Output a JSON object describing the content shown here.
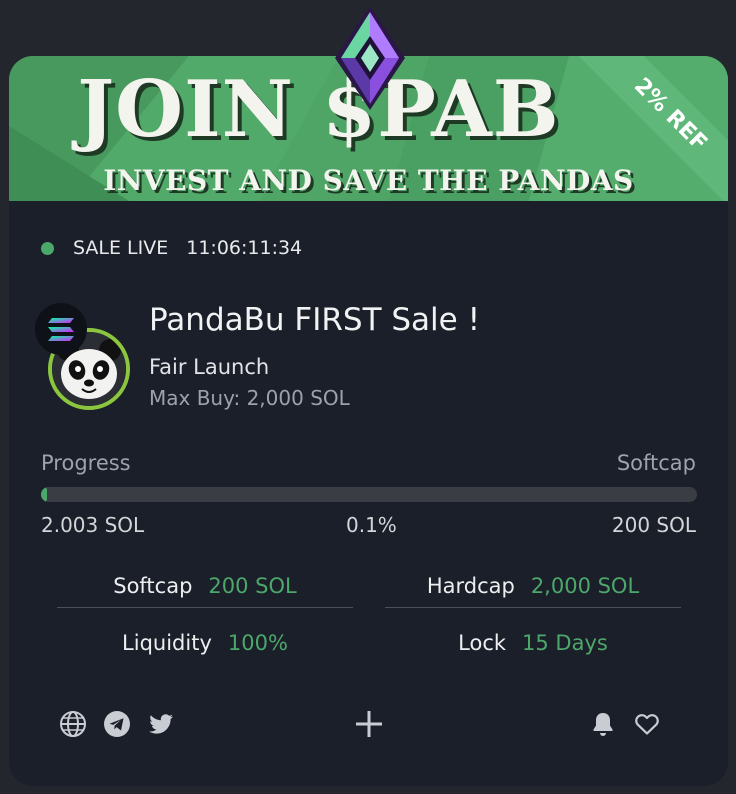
{
  "banner": {
    "title": "JOIN $PAB",
    "subtitle": "INVEST AND SAVE THE PANDAS",
    "ribbon": "2% REF",
    "colors": {
      "background": "#4fa566",
      "text": "#f4f4ee",
      "ribbon": "#5fb879"
    }
  },
  "status": {
    "label": "SALE LIVE",
    "timer": "11:06:11:34",
    "dot_color": "#4ca86a"
  },
  "sale": {
    "title": "PandaBu FIRST Sale !",
    "type": "Fair Launch",
    "max_buy": "Max Buy: 2,000 SOL",
    "avatar_icon": "panda-icon",
    "chain_icon": "solana-icon"
  },
  "progress": {
    "label": "Progress",
    "right_label": "Softcap",
    "raised": "2.003 SOL",
    "percent_text": "0.1%",
    "percent_value": 0.1,
    "cap": "200 SOL",
    "fill_color": "#4ca86a"
  },
  "stats": {
    "softcap_label": "Softcap",
    "softcap_value": "200 SOL",
    "hardcap_label": "Hardcap",
    "hardcap_value": "2,000 SOL",
    "liquidity_label": "Liquidity",
    "liquidity_value": "100%",
    "lock_label": "Lock",
    "lock_value": "15 Days",
    "value_color": "#4ca86a"
  },
  "footer": {
    "left_icons": [
      "globe-icon",
      "telegram-icon",
      "twitter-icon"
    ],
    "center_icon": "plus-icon",
    "right_icons": [
      "bell-icon",
      "heart-icon"
    ]
  }
}
